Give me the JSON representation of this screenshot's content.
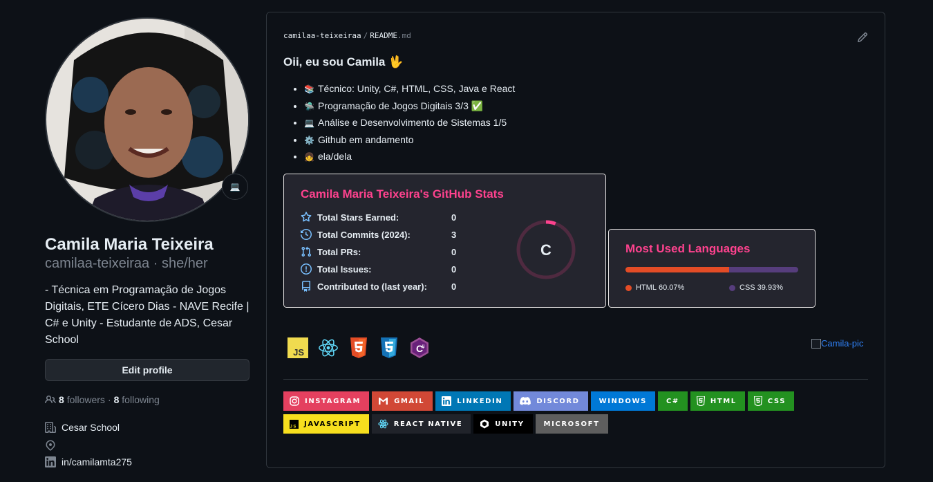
{
  "profile": {
    "full_name": "Camila Maria Teixeira",
    "username_line": "camilaa-teixeiraa · she/her",
    "bio": "- Técnica em Programação de Jogos Digitais, ETE Cícero Dias - NAVE Recife | C# e Unity - Estudante de ADS, Cesar School",
    "status_emoji": "💻",
    "edit_profile_label": "Edit profile",
    "followers_count": "8",
    "followers_label": "followers",
    "separator": "·",
    "following_count": "8",
    "following_label": "following",
    "company": "Cesar School",
    "location": "",
    "linkedin": "in/camilamta275"
  },
  "readme": {
    "breadcrumb_user": "camilaa-teixeiraa",
    "breadcrumb_sep": "/",
    "breadcrumb_file": "README",
    "breadcrumb_ext": ".md",
    "heading": "Oii, eu sou Camila 🖖",
    "bullets": [
      {
        "emoji": "📚",
        "text": "Técnico: Unity, C#, HTML, CSS, Java e React"
      },
      {
        "emoji": "🛸",
        "text": "Programação de Jogos Digitais 3/3 ✅"
      },
      {
        "emoji": "💻",
        "text": "Análise e Desenvolvimento de Sistemas 1/5"
      },
      {
        "emoji": "⚙️",
        "text": "Github em andamento"
      },
      {
        "emoji": "👧",
        "text": "ela/dela"
      }
    ],
    "stats_card": {
      "title": "Camila Maria Teixeira's GitHub Stats",
      "rows": [
        {
          "icon": "star-icon",
          "label": "Total Stars Earned:",
          "value": "0"
        },
        {
          "icon": "history-icon",
          "label": "Total Commits (2024):",
          "value": "3"
        },
        {
          "icon": "pull-request-icon",
          "label": "Total PRs:",
          "value": "0"
        },
        {
          "icon": "issue-icon",
          "label": "Total Issues:",
          "value": "0"
        },
        {
          "icon": "repo-icon",
          "label": "Contributed to (last year):",
          "value": "0"
        }
      ],
      "rank": "C",
      "colors": {
        "title": "#fe428e",
        "icon": "#f8d847",
        "ring": "#fe428e",
        "bg": "#24252e"
      }
    },
    "languages_card": {
      "title": "Most Used Languages",
      "languages": [
        {
          "name": "HTML",
          "percent": "60.07%",
          "fraction": 0.6007,
          "color": "#e34c26"
        },
        {
          "name": "CSS",
          "percent": "39.93%",
          "fraction": 0.3993,
          "color": "#563d7c"
        }
      ]
    },
    "tech_icons": [
      "javascript-icon",
      "react-icon",
      "html5-icon",
      "css3-icon",
      "csharp-icon"
    ],
    "broken_image_alt": "Camila-pic",
    "badges": [
      {
        "name": "instagram",
        "label": "INSTAGRAM",
        "bg": "#e4405f",
        "fg": "#ffffff",
        "icon": "instagram-icon"
      },
      {
        "name": "gmail",
        "label": "GMAIL",
        "bg": "#d14836",
        "fg": "#ffffff",
        "icon": "gmail-icon"
      },
      {
        "name": "linkedin",
        "label": "LINKEDIN",
        "bg": "#0077b5",
        "fg": "#ffffff",
        "icon": "linkedin-icon"
      },
      {
        "name": "discord",
        "label": "DISCORD",
        "bg": "#7289da",
        "fg": "#ffffff",
        "icon": "discord-icon"
      },
      {
        "name": "windows",
        "label": "WINDOWS",
        "bg": "#0078d6",
        "fg": "#ffffff",
        "icon": ""
      },
      {
        "name": "csharp",
        "label": "C#",
        "bg": "#239120",
        "fg": "#ffffff",
        "icon": ""
      },
      {
        "name": "html",
        "label": "HTML",
        "bg": "#239120",
        "fg": "#ffffff",
        "icon": "html5-icon"
      },
      {
        "name": "css",
        "label": "CSS",
        "bg": "#239120",
        "fg": "#ffffff",
        "icon": "css3-icon"
      },
      {
        "name": "javascript",
        "label": "JAVASCRIPT",
        "bg": "#f7df1e",
        "fg": "#000000",
        "icon": "javascript-icon"
      },
      {
        "name": "react-native",
        "label": "REACT NATIVE",
        "bg": "#20232a",
        "fg": "#ffffff",
        "icon": "react-icon"
      },
      {
        "name": "unity",
        "label": "UNITY",
        "bg": "#000000",
        "fg": "#ffffff",
        "icon": "unity-icon"
      },
      {
        "name": "microsoft",
        "label": "MICROSOFT",
        "bg": "#5e5e5e",
        "fg": "#ffffff",
        "icon": ""
      }
    ]
  }
}
